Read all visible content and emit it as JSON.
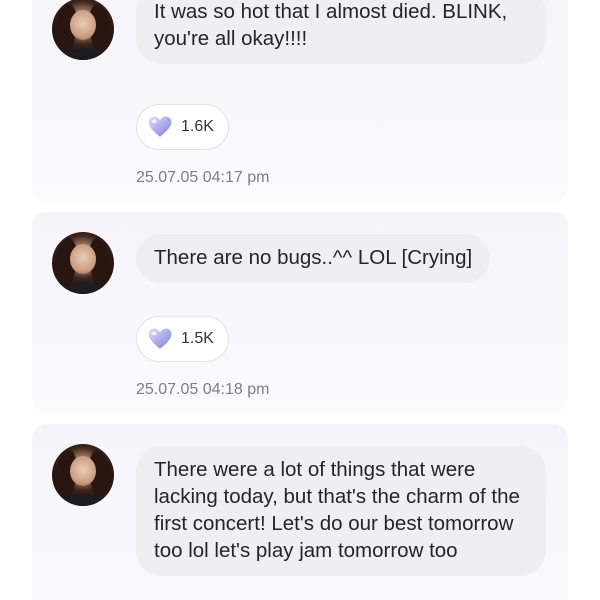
{
  "posts": [
    {
      "message": "It was so hot that I almost died. BLINK, you're all okay!!!!",
      "reaction_count": "1.6K",
      "reaction_icon": "heart-icon",
      "timestamp": "25.07.05 04:17 pm"
    },
    {
      "message": "There are no bugs..^^ LOL [Crying]",
      "reaction_count": "1.5K",
      "reaction_icon": "heart-icon",
      "timestamp": "25.07.05 04:18 pm"
    },
    {
      "message": "There were a lot of things that were lacking today, but that's the charm of the first concert! Let's do our best tomorrow too lol let's play jam tomorrow too"
    }
  ],
  "colors": {
    "bubble": "#efeff2",
    "card": "#f4f4fa",
    "heart": "#b8b8f0",
    "timestamp": "#7d7d86"
  }
}
